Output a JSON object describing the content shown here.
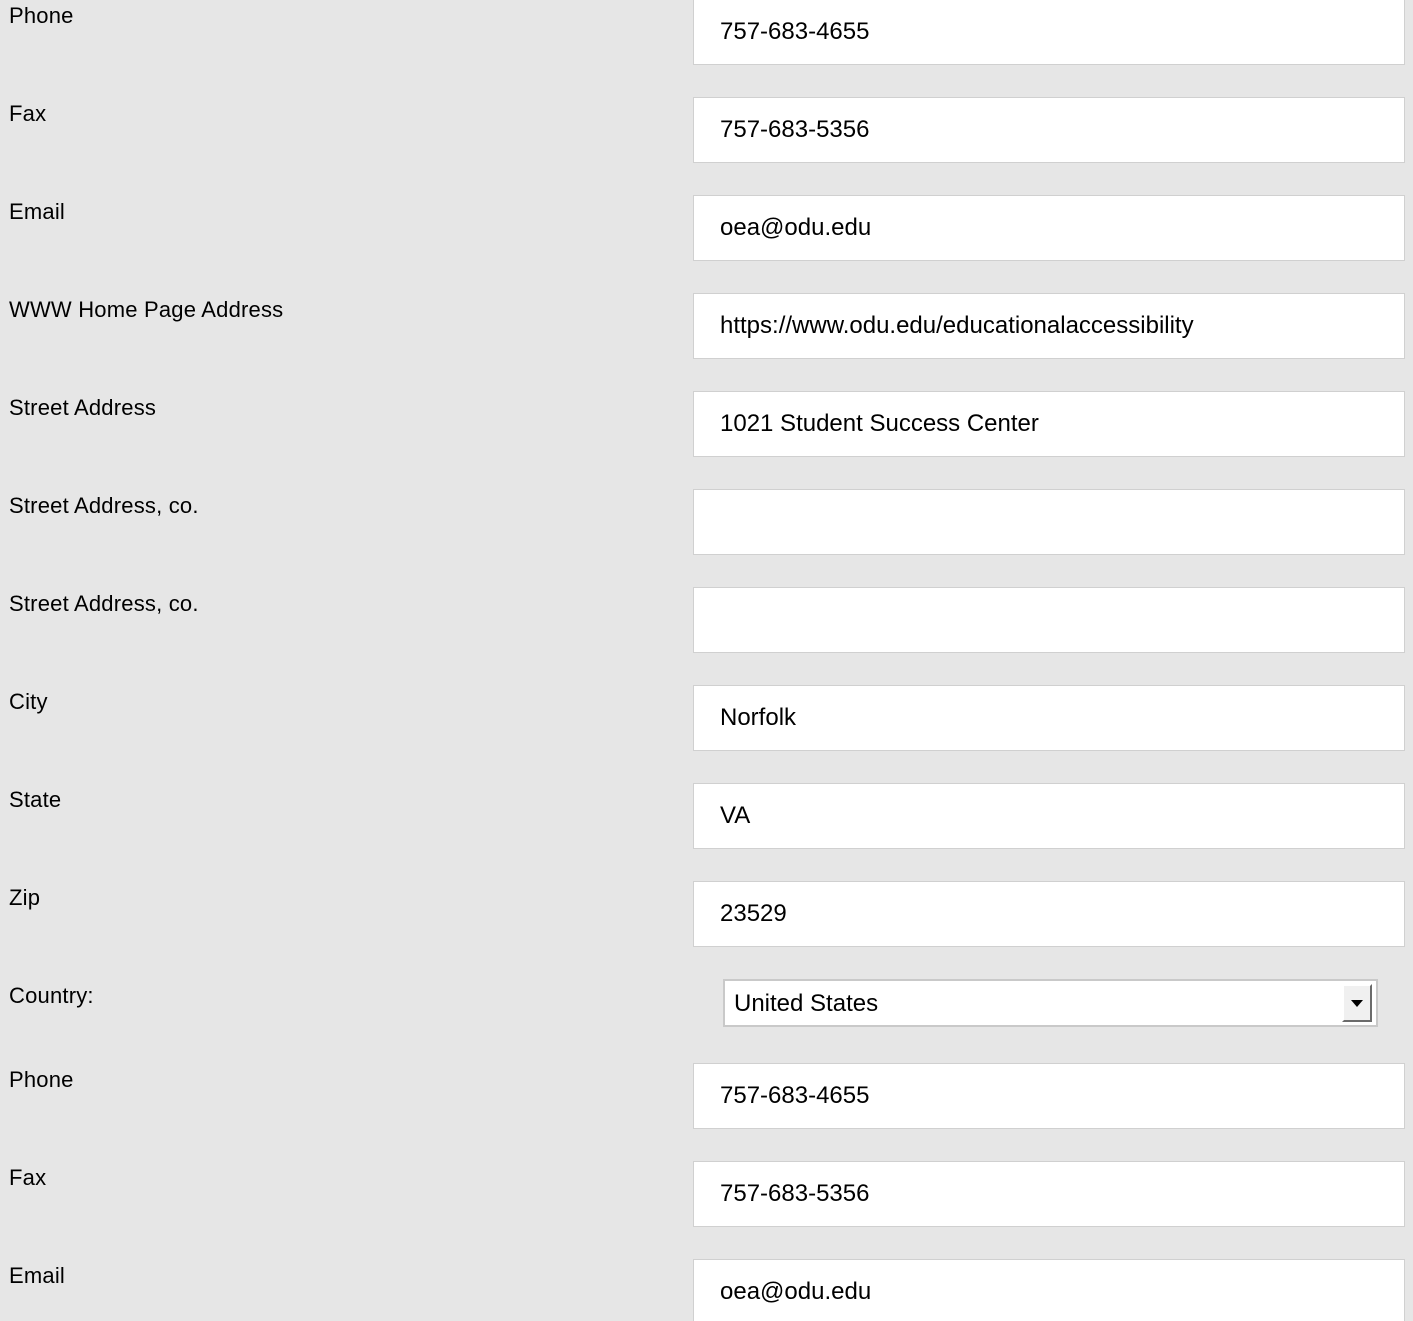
{
  "form": {
    "rows": [
      {
        "label": "Phone",
        "value": "757-683-4655"
      },
      {
        "label": "Fax",
        "value": "757-683-5356"
      },
      {
        "label": "Email",
        "value": "oea@odu.edu"
      },
      {
        "label": "WWW Home Page Address",
        "value": "https://www.odu.edu/educationalaccessibility"
      },
      {
        "label": "Street Address",
        "value": "1021 Student Success Center"
      },
      {
        "label": "Street Address, co.",
        "value": ""
      },
      {
        "label": "Street Address, co.",
        "value": ""
      },
      {
        "label": "City",
        "value": "Norfolk"
      },
      {
        "label": "State",
        "value": "VA"
      },
      {
        "label": "Zip",
        "value": "23529"
      },
      {
        "label": "Country:",
        "value": "United States"
      },
      {
        "label": "Phone",
        "value": "757-683-4655"
      },
      {
        "label": "Fax",
        "value": "757-683-5356"
      },
      {
        "label": "Email",
        "value": "oea@odu.edu"
      }
    ]
  },
  "icons": {
    "country_dropdown": "chevron-down-icon"
  },
  "colors": {
    "page_background": "#e6e6e6",
    "field_background": "#ffffff",
    "field_border": "#d0d0d0"
  }
}
